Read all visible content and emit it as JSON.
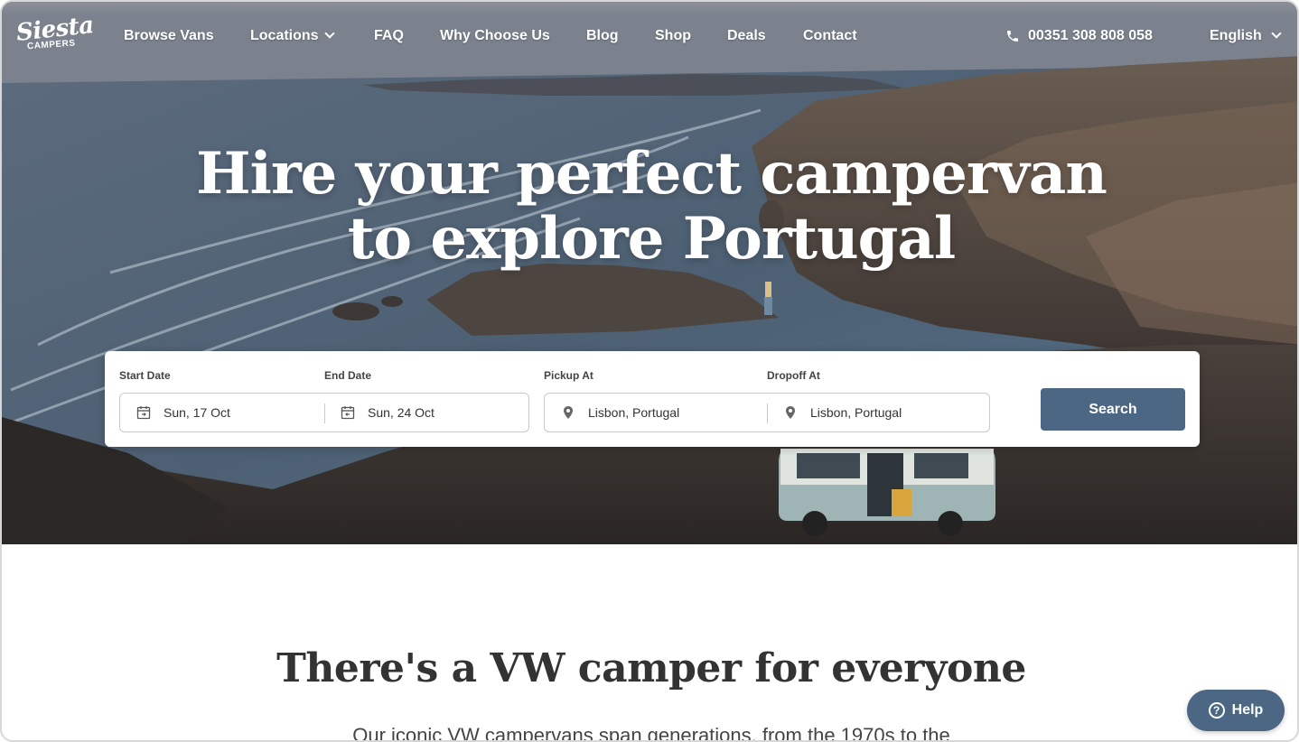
{
  "brand": {
    "logo_line1": "Siesta",
    "logo_line2": "CAMPERS"
  },
  "nav": {
    "items": [
      {
        "label": "Browse Vans"
      },
      {
        "label": "Locations"
      },
      {
        "label": "FAQ"
      },
      {
        "label": "Why Choose Us"
      },
      {
        "label": "Blog"
      },
      {
        "label": "Shop"
      },
      {
        "label": "Deals"
      },
      {
        "label": "Contact"
      }
    ],
    "phone": "00351 308 808 058",
    "language": "English",
    "phone_icon": "phone-icon",
    "dropdown_icon": "chevron-down-icon"
  },
  "hero": {
    "headline_line1": "Hire your perfect campervan",
    "headline_line2": "to explore Portugal"
  },
  "search": {
    "start_label": "Start Date",
    "start_value": "Sun, 17 Oct",
    "end_label": "End Date",
    "end_value": "Sun, 24 Oct",
    "pickup_label": "Pickup At",
    "pickup_value": "Lisbon, Portugal",
    "dropoff_label": "Dropoff At",
    "dropoff_value": "Lisbon, Portugal",
    "button_label": "Search",
    "calendar_icon": "calendar-icon",
    "location_icon": "map-pin-icon"
  },
  "section": {
    "title": "There's a VW camper for everyone",
    "text": "Our iconic VW campervans span generations, from the 1970s to the"
  },
  "help": {
    "label": "Help",
    "icon": "question-circle-icon"
  },
  "colors": {
    "accent": "#4b6784",
    "text": "#333333",
    "white": "#ffffff"
  }
}
